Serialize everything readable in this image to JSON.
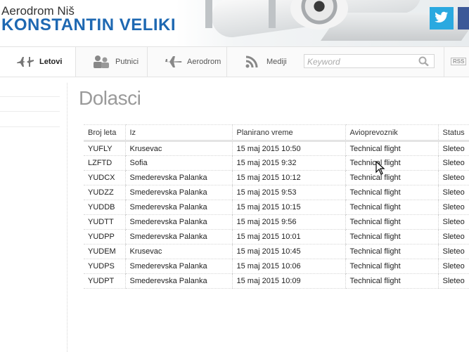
{
  "header": {
    "subtitle": "Aerodrom Niš",
    "title": "KONSTANTIN VELIKI",
    "colors": {
      "brand_blue": "#1e68b2",
      "twitter": "#2aa9e0",
      "facebook": "#3b5998"
    }
  },
  "nav": {
    "items": [
      {
        "label": "Letovi",
        "icon": "plane-arrivals-icon"
      },
      {
        "label": "Putnici",
        "icon": "passengers-icon"
      },
      {
        "label": "Aerodrom",
        "icon": "airplane-icon"
      },
      {
        "label": "Mediji",
        "icon": "rss-feed-icon"
      }
    ],
    "search_placeholder": "Keyword",
    "rss_label": "RSS"
  },
  "page": {
    "title": "Dolasci"
  },
  "table": {
    "headers": [
      "Broj leta",
      "Iz",
      "Planirano vreme",
      "Avioprevoznik",
      "Status"
    ],
    "rows": [
      [
        "YUFLY",
        "Krusevac",
        "15 maj 2015 10:50",
        "Technical flight",
        "Sleteo"
      ],
      [
        "LZFTD",
        "Sofia",
        "15 maj 2015 9:32",
        "Technical flight",
        "Sleteo"
      ],
      [
        "YUDCX",
        "Smederevska Palanka",
        "15 maj 2015 10:12",
        "Technical flight",
        "Sleteo"
      ],
      [
        "YUDZZ",
        "Smederevska Palanka",
        "15 maj 2015 9:53",
        "Technical flight",
        "Sleteo"
      ],
      [
        "YUDDB",
        "Smederevska Palanka",
        "15 maj 2015 10:15",
        "Technical flight",
        "Sleteo"
      ],
      [
        "YUDTT",
        "Smederevska Palanka",
        "15 maj 2015 9:56",
        "Technical flight",
        "Sleteo"
      ],
      [
        "YUDPP",
        "Smederevska Palanka",
        "15 maj 2015 10:01",
        "Technical flight",
        "Sleteo"
      ],
      [
        "YUDEM",
        "Krusevac",
        "15 maj 2015 10:45",
        "Technical flight",
        "Sleteo"
      ],
      [
        "YUDPS",
        "Smederevska Palanka",
        "15 maj 2015 10:06",
        "Technical flight",
        "Sleteo"
      ],
      [
        "YUDPT",
        "Smederevska Palanka",
        "15 maj 2015 10:09",
        "Technical flight",
        "Sleteo"
      ]
    ]
  }
}
